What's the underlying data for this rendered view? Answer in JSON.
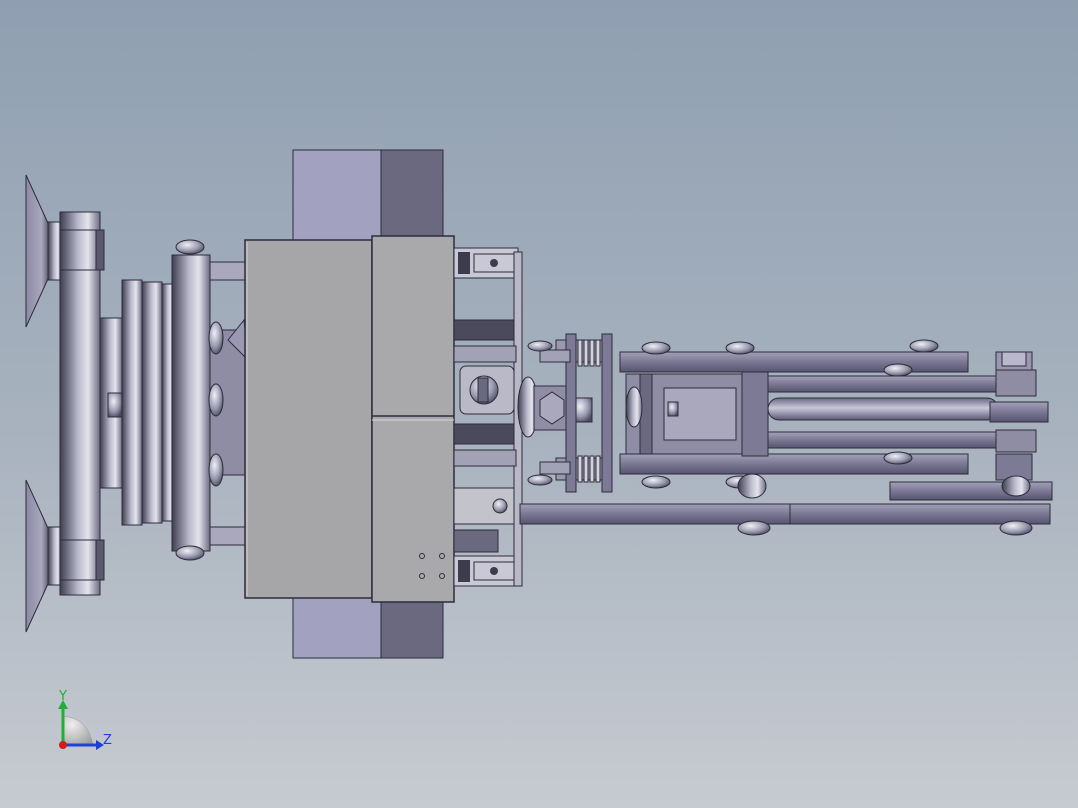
{
  "view": {
    "type": "3d-cad-viewport",
    "background_top": "#8f9fb1",
    "background_bottom": "#c7cbd1"
  },
  "triad": {
    "y_label": "Y",
    "z_label": "Z",
    "y_color": "#1fae3a",
    "z_color": "#1f3fd8",
    "x_color": "#d21d1d"
  },
  "model": {
    "palette": {
      "metal_dark": "#4b4a5c",
      "metal_mid": "#8c8ca2",
      "metal_light": "#d9d9e3",
      "panel_gray": "#a7a7a9",
      "block_light": "#a2a2c0",
      "block_dark": "#6b6980",
      "link_purple": "#7d7a95",
      "rod": "#9a98b0"
    }
  }
}
